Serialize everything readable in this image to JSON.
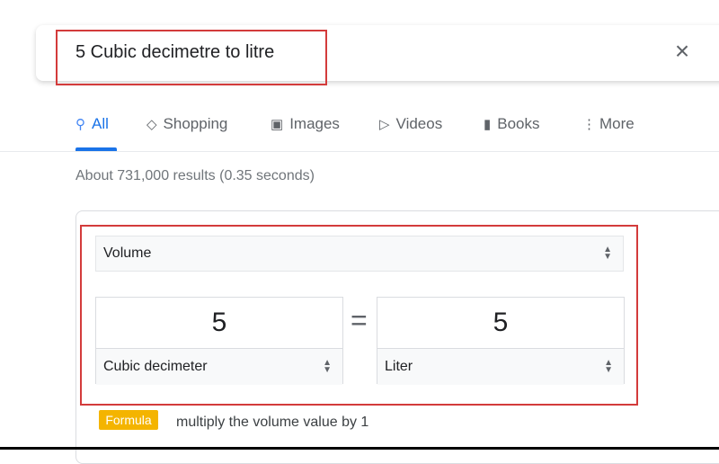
{
  "search": {
    "query": "5 Cubic decimetre to litre",
    "close_icon": "close-icon"
  },
  "tabs": [
    {
      "label": "All",
      "icon": "search-icon",
      "active": true
    },
    {
      "label": "Shopping",
      "icon": "tag-icon"
    },
    {
      "label": "Images",
      "icon": "image-icon"
    },
    {
      "label": "Videos",
      "icon": "play-icon"
    },
    {
      "label": "Books",
      "icon": "book-icon"
    },
    {
      "label": "More",
      "icon": "more-vert-icon"
    }
  ],
  "results_stats": "About 731,000 results (0.35 seconds)",
  "converter": {
    "quantity": "Volume",
    "from": {
      "value": "5",
      "unit": "Cubic decimeter"
    },
    "equals": "=",
    "to": {
      "value": "5",
      "unit": "Liter"
    },
    "formula_badge": "Formula",
    "formula_text": "multiply the volume value by 1"
  },
  "colors": {
    "accent": "#1a73e8",
    "highlight": "#d33b3b",
    "badge": "#f4b400"
  }
}
